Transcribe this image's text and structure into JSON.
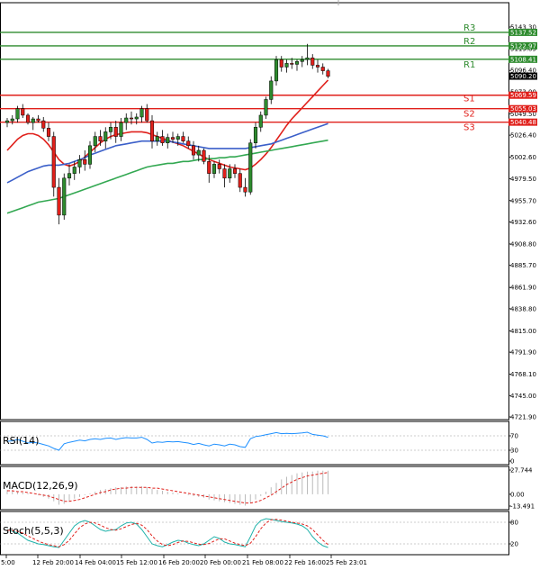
{
  "chart_data": {
    "type": "candlestick",
    "instrument_panel": {
      "price_axis_ticks": [
        "5143.30",
        "5119.85",
        "5096.40",
        "5073.00",
        "5049.50",
        "5026.40",
        "5002.60",
        "4979.50",
        "4955.70",
        "4932.60",
        "4908.80",
        "4885.70",
        "4861.90",
        "4838.80",
        "4815.00",
        "4791.90",
        "4768.10",
        "4745.00",
        "4721.90"
      ],
      "ylim": [
        4721.9,
        5143.3
      ],
      "current_price": "5090.20",
      "levels": [
        {
          "name": "R3",
          "value": 5137.52,
          "label": "5137.52",
          "color": "#2e8b2e"
        },
        {
          "name": "R2",
          "value": 5122.97,
          "label": "5122.97",
          "color": "#2e8b2e"
        },
        {
          "name": "R1",
          "value": 5108.41,
          "label": "5108.41",
          "color": "#2e8b2e"
        },
        {
          "name": "S1",
          "value": 5069.59,
          "label": "5069.59",
          "color": "#e0201b"
        },
        {
          "name": "S2",
          "value": 5055.03,
          "label": "5055.03",
          "color": "#e0201b"
        },
        {
          "name": "S3",
          "value": 5040.48,
          "label": "5040.48",
          "color": "#e0201b"
        }
      ],
      "candles_ohlc": [
        [
          5040,
          5045,
          5035,
          5042
        ],
        [
          5042,
          5048,
          5038,
          5044
        ],
        [
          5044,
          5058,
          5040,
          5055
        ],
        [
          5055,
          5060,
          5045,
          5048
        ],
        [
          5048,
          5050,
          5038,
          5040
        ],
        [
          5040,
          5046,
          5032,
          5044
        ],
        [
          5044,
          5048,
          5040,
          5042
        ],
        [
          5042,
          5046,
          5030,
          5034
        ],
        [
          5034,
          5040,
          5020,
          5025
        ],
        [
          5025,
          5030,
          4960,
          4970
        ],
        [
          4970,
          4980,
          4930,
          4940
        ],
        [
          4940,
          4985,
          4935,
          4980
        ],
        [
          4980,
          4995,
          4972,
          4985
        ],
        [
          4985,
          4998,
          4978,
          4992
        ],
        [
          4992,
          5005,
          4985,
          5000
        ],
        [
          5000,
          5010,
          4988,
          4995
        ],
        [
          4995,
          5020,
          4990,
          5015
        ],
        [
          5015,
          5030,
          5008,
          5025
        ],
        [
          5025,
          5032,
          5015,
          5020
        ],
        [
          5020,
          5035,
          5012,
          5030
        ],
        [
          5030,
          5040,
          5022,
          5035
        ],
        [
          5035,
          5042,
          5018,
          5025
        ],
        [
          5025,
          5045,
          5020,
          5040
        ],
        [
          5040,
          5050,
          5032,
          5045
        ],
        [
          5045,
          5052,
          5038,
          5044
        ],
        [
          5044,
          5050,
          5038,
          5046
        ],
        [
          5046,
          5058,
          5040,
          5055
        ],
        [
          5055,
          5060,
          5040,
          5042
        ],
        [
          5042,
          5048,
          5012,
          5020
        ],
        [
          5020,
          5030,
          5015,
          5025
        ],
        [
          5025,
          5032,
          5015,
          5018
        ],
        [
          5018,
          5028,
          5012,
          5024
        ],
        [
          5024,
          5030,
          5018,
          5022
        ],
        [
          5022,
          5028,
          5015,
          5025
        ],
        [
          5025,
          5030,
          5018,
          5020
        ],
        [
          5020,
          5025,
          5012,
          5015
        ],
        [
          5015,
          5020,
          5000,
          5005
        ],
        [
          5005,
          5015,
          4998,
          5010
        ],
        [
          5010,
          5012,
          4995,
          4998
        ],
        [
          4998,
          5005,
          4975,
          4985
        ],
        [
          4985,
          4998,
          4980,
          4995
        ],
        [
          4995,
          5000,
          4985,
          4990
        ],
        [
          4990,
          4995,
          4970,
          4980
        ],
        [
          4980,
          4995,
          4975,
          4990
        ],
        [
          4990,
          4995,
          4980,
          4985
        ],
        [
          4985,
          4990,
          4965,
          4970
        ],
        [
          4970,
          4980,
          4960,
          4965
        ],
        [
          4965,
          5022,
          4962,
          5018
        ],
        [
          5018,
          5040,
          5012,
          5035
        ],
        [
          5035,
          5052,
          5030,
          5048
        ],
        [
          5048,
          5068,
          5044,
          5065
        ],
        [
          5065,
          5090,
          5060,
          5085
        ],
        [
          5085,
          5112,
          5080,
          5108
        ],
        [
          5108,
          5112,
          5095,
          5100
        ],
        [
          5100,
          5108,
          5094,
          5104
        ],
        [
          5104,
          5110,
          5098,
          5103
        ],
        [
          5103,
          5108,
          5096,
          5106
        ],
        [
          5106,
          5112,
          5100,
          5108
        ],
        [
          5108,
          5125,
          5102,
          5110
        ],
        [
          5110,
          5114,
          5098,
          5102
        ],
        [
          5102,
          5108,
          5094,
          5100
        ],
        [
          5100,
          5104,
          5092,
          5096
        ],
        [
          5096,
          5098,
          5088,
          5090
        ]
      ],
      "moving_averages": [
        {
          "color": "#e0201b",
          "values": [
            5010,
            5016,
            5022,
            5026,
            5028,
            5028,
            5026,
            5022,
            5016,
            5008,
            5000,
            4995,
            4993,
            4995,
            4998,
            5003,
            5008,
            5013,
            5018,
            5022,
            5025,
            5027,
            5028,
            5029,
            5030,
            5030,
            5030,
            5029,
            5027,
            5025,
            5023,
            5021,
            5019,
            5017,
            5015,
            5012,
            5009,
            5006,
            5003,
            5000,
            4998,
            4996,
            4994,
            4992,
            4991,
            4990,
            4989,
            4991,
            4995,
            5000,
            5006,
            5013,
            5021,
            5029,
            5037,
            5044,
            5050,
            5056,
            5062,
            5068,
            5074,
            5080,
            5086
          ]
        },
        {
          "color": "#3b5fc9",
          "values": [
            4975,
            4978,
            4981,
            4984,
            4987,
            4989,
            4991,
            4993,
            4994,
            4994,
            4994,
            4995,
            4996,
            4998,
            5000,
            5002,
            5005,
            5007,
            5009,
            5011,
            5013,
            5015,
            5016,
            5017,
            5018,
            5019,
            5020,
            5020,
            5020,
            5020,
            5020,
            5020,
            5019,
            5018,
            5017,
            5016,
            5015,
            5014,
            5013,
            5012,
            5012,
            5012,
            5012,
            5012,
            5012,
            5012,
            5012,
            5013,
            5014,
            5015,
            5016,
            5017,
            5019,
            5021,
            5023,
            5025,
            5027,
            5029,
            5031,
            5033,
            5035,
            5037,
            5039
          ]
        },
        {
          "color": "#33a852",
          "values": [
            4942,
            4944,
            4946,
            4948,
            4950,
            4952,
            4954,
            4955,
            4956,
            4957,
            4958,
            4960,
            4962,
            4964,
            4966,
            4968,
            4970,
            4972,
            4974,
            4976,
            4978,
            4980,
            4982,
            4984,
            4986,
            4988,
            4990,
            4992,
            4993,
            4994,
            4995,
            4996,
            4996,
            4997,
            4998,
            4998,
            4999,
            5000,
            5000,
            5001,
            5001,
            5002,
            5002,
            5003,
            5003,
            5004,
            5005,
            5006,
            5007,
            5008,
            5009,
            5010,
            5011,
            5012,
            5013,
            5014,
            5015,
            5016,
            5017,
            5018,
            5019,
            5020,
            5021
          ]
        }
      ]
    },
    "indicators": [
      {
        "name": "RSI(14)",
        "ticks": [
          "70",
          "30",
          "0"
        ],
        "ylim": [
          0,
          100
        ],
        "values": [
          55,
          56,
          60,
          55,
          50,
          52,
          50,
          46,
          42,
          35,
          30,
          48,
          52,
          55,
          58,
          56,
          60,
          62,
          60,
          63,
          64,
          60,
          63,
          65,
          64,
          64,
          66,
          60,
          50,
          53,
          52,
          54,
          53,
          54,
          52,
          50,
          46,
          49,
          45,
          42,
          47,
          45,
          42,
          47,
          45,
          40,
          38,
          62,
          68,
          70,
          73,
          76,
          79,
          76,
          77,
          76,
          77,
          78,
          80,
          74,
          72,
          70,
          66
        ]
      },
      {
        "name": "MACD(12,26,9)",
        "ticks": [
          "27.744",
          "0.00",
          "-13.491"
        ],
        "ylim": [
          -13.491,
          27.744
        ],
        "values": [
          5,
          4,
          3,
          2,
          1,
          0,
          -1,
          -3,
          -5,
          -8,
          -12,
          -11,
          -8,
          -5,
          -3,
          -1,
          1,
          3,
          5,
          6,
          7,
          8,
          8,
          9,
          9,
          9,
          9,
          8,
          6,
          5,
          4,
          3,
          2,
          1,
          0,
          -1,
          -2,
          -3,
          -4,
          -6,
          -7,
          -8,
          -9,
          -10,
          -11,
          -12,
          -13,
          -10,
          -6,
          -2,
          3,
          8,
          13,
          17,
          20,
          22,
          24,
          25,
          26,
          26,
          27,
          27,
          27
        ],
        "signal": [
          4,
          4,
          3,
          3,
          2,
          1,
          0,
          -1,
          -2,
          -4,
          -6,
          -8,
          -8,
          -7,
          -6,
          -4,
          -2,
          0,
          2,
          3,
          5,
          6,
          7,
          7,
          8,
          8,
          8,
          8,
          7,
          7,
          6,
          5,
          4,
          3,
          2,
          1,
          0,
          -1,
          -2,
          -3,
          -4,
          -5,
          -6,
          -7,
          -8,
          -9,
          -10,
          -10,
          -9,
          -7,
          -4,
          -1,
          3,
          7,
          11,
          14,
          17,
          19,
          21,
          22,
          23,
          24,
          25
        ]
      },
      {
        "name": "Stoch(5,5,3)",
        "ticks": [
          "80",
          "20"
        ],
        "ylim": [
          0,
          100
        ],
        "values": [
          60,
          55,
          50,
          40,
          30,
          25,
          20,
          18,
          15,
          12,
          10,
          30,
          50,
          70,
          80,
          85,
          80,
          70,
          60,
          55,
          58,
          60,
          70,
          78,
          80,
          75,
          60,
          40,
          20,
          15,
          12,
          18,
          25,
          30,
          28,
          22,
          18,
          15,
          20,
          30,
          40,
          35,
          25,
          20,
          18,
          15,
          12,
          40,
          70,
          85,
          90,
          88,
          85,
          82,
          80,
          78,
          75,
          70,
          60,
          40,
          25,
          15,
          10
        ],
        "signal": [
          58,
          57,
          55,
          50,
          42,
          35,
          28,
          22,
          18,
          15,
          12,
          18,
          30,
          48,
          65,
          75,
          80,
          78,
          72,
          65,
          60,
          58,
          62,
          68,
          74,
          77,
          72,
          60,
          42,
          28,
          18,
          15,
          18,
          24,
          28,
          27,
          23,
          19,
          18,
          21,
          28,
          34,
          34,
          28,
          22,
          18,
          15,
          22,
          40,
          62,
          78,
          87,
          88,
          86,
          83,
          80,
          78,
          75,
          70,
          60,
          45,
          30,
          18
        ]
      }
    ],
    "x_tick_labels": [
      "5:00",
      "12 Feb 20:00",
      "14 Feb 04:00",
      "15 Feb 12:00",
      "16 Feb 20:00",
      "20 Feb 00:00",
      "21 Feb 08:00",
      "22 Feb 16:00",
      "25 Feb 23:01"
    ]
  }
}
